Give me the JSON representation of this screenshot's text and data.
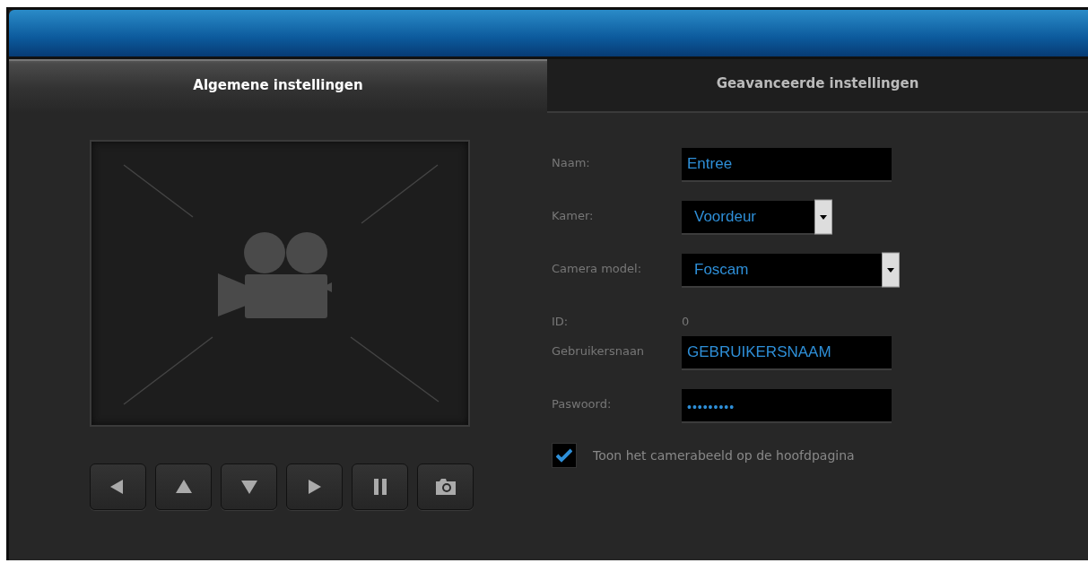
{
  "tabs": [
    {
      "label": "Algemene instellingen",
      "selected": true
    },
    {
      "label": "Geavanceerde instellingen",
      "selected": false
    }
  ],
  "preview": {
    "kind": "placeholder"
  },
  "controls": [
    {
      "kind": "left"
    },
    {
      "kind": "up"
    },
    {
      "kind": "down"
    },
    {
      "kind": "right"
    },
    {
      "kind": "pause"
    },
    {
      "kind": "snapshot"
    }
  ],
  "form": {
    "fields": [
      {
        "label": "Naam:",
        "kind": "text",
        "value": "Entree"
      },
      {
        "label": "Kamer:",
        "kind": "select",
        "value": "Voordeur"
      },
      {
        "label": "Camera model:",
        "kind": "select-wide",
        "value": "Foscam"
      },
      {
        "label": "ID:",
        "kind": "static",
        "value": "0"
      },
      {
        "label": "Gebruikersnaan",
        "kind": "text",
        "value": "GEBRUIKERSNAAM"
      },
      {
        "label": "Paswoord:",
        "kind": "password",
        "value": "•••••••••"
      }
    ],
    "checkbox": {
      "label": "Toon het camerabeeld op de hoofdpagina",
      "checked": true
    }
  }
}
